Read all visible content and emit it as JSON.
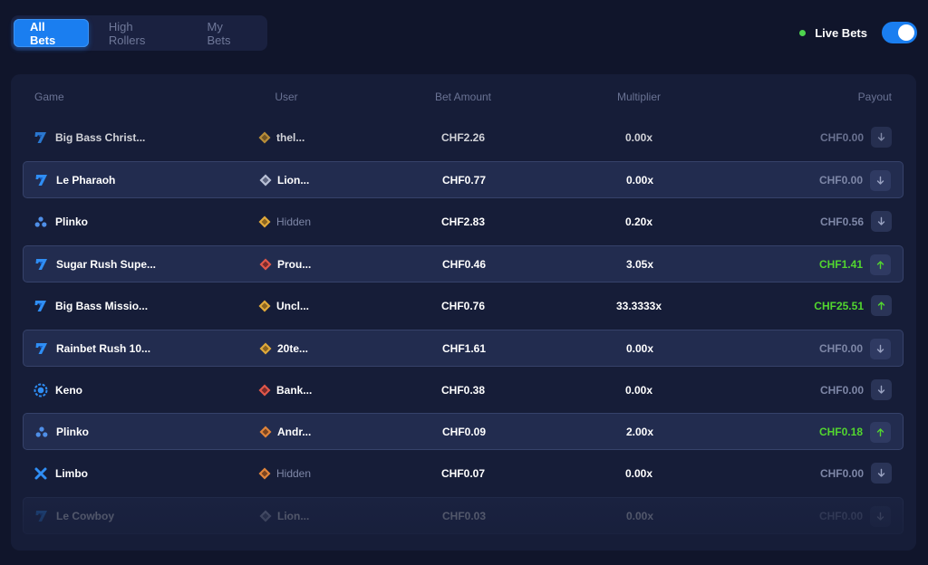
{
  "tabs": [
    {
      "label": "All Bets",
      "active": true
    },
    {
      "label": "High Rollers",
      "active": false
    },
    {
      "label": "My Bets",
      "active": false
    }
  ],
  "live_bets": {
    "label": "Live Bets",
    "enabled": true
  },
  "table": {
    "headers": {
      "game": "Game",
      "user": "User",
      "amount": "Bet Amount",
      "multiplier": "Multiplier",
      "payout": "Payout"
    },
    "rows": [
      {
        "game": "Big Bass Christ...",
        "game_icon": "seven-icon",
        "user": "thel...",
        "user_icon": "gold-rank-icon",
        "amount": "CHF2.26",
        "multiplier": "0.00x",
        "payout": "CHF0.00",
        "win": false
      },
      {
        "game": "Le Pharaoh",
        "game_icon": "seven-icon",
        "user": "Lion...",
        "user_icon": "silver-rank-icon",
        "amount": "CHF0.77",
        "multiplier": "0.00x",
        "payout": "CHF0.00",
        "win": false
      },
      {
        "game": "Plinko",
        "game_icon": "plinko-icon",
        "user": "Hidden",
        "user_icon": "gold-rank-icon",
        "amount": "CHF2.83",
        "multiplier": "0.20x",
        "payout": "CHF0.56",
        "win": false
      },
      {
        "game": "Sugar Rush Supe...",
        "game_icon": "seven-icon",
        "user": "Prou...",
        "user_icon": "ruby-rank-icon",
        "amount": "CHF0.46",
        "multiplier": "3.05x",
        "payout": "CHF1.41",
        "win": true
      },
      {
        "game": "Big Bass Missio...",
        "game_icon": "seven-icon",
        "user": "Uncl...",
        "user_icon": "gold-rank-icon",
        "amount": "CHF0.76",
        "multiplier": "33.3333x",
        "payout": "CHF25.51",
        "win": true
      },
      {
        "game": "Rainbet Rush 10...",
        "game_icon": "seven-icon",
        "user": "20te...",
        "user_icon": "gold-rank-icon",
        "amount": "CHF1.61",
        "multiplier": "0.00x",
        "payout": "CHF0.00",
        "win": false
      },
      {
        "game": "Keno",
        "game_icon": "keno-icon",
        "user": "Bank...",
        "user_icon": "ruby-rank-icon",
        "amount": "CHF0.38",
        "multiplier": "0.00x",
        "payout": "CHF0.00",
        "win": false
      },
      {
        "game": "Plinko",
        "game_icon": "plinko-icon",
        "user": "Andr...",
        "user_icon": "bronze-rank-icon",
        "amount": "CHF0.09",
        "multiplier": "2.00x",
        "payout": "CHF0.18",
        "win": true
      },
      {
        "game": "Limbo",
        "game_icon": "limbo-icon",
        "user": "Hidden",
        "user_icon": "bronze-rank-icon",
        "amount": "CHF0.07",
        "multiplier": "0.00x",
        "payout": "CHF0.00",
        "win": false
      },
      {
        "game": "Le Cowboy",
        "game_icon": "seven-icon",
        "user": "Lion...",
        "user_icon": "silver-rank-icon",
        "amount": "CHF0.03",
        "multiplier": "0.00x",
        "payout": "CHF0.00",
        "win": false
      }
    ]
  },
  "colors": {
    "background": "#10152b",
    "panel": "#161d38",
    "accent": "#1a7ef0",
    "win": "#52d62f",
    "muted": "#7e87a7",
    "live_dot": "#4ed34e"
  }
}
